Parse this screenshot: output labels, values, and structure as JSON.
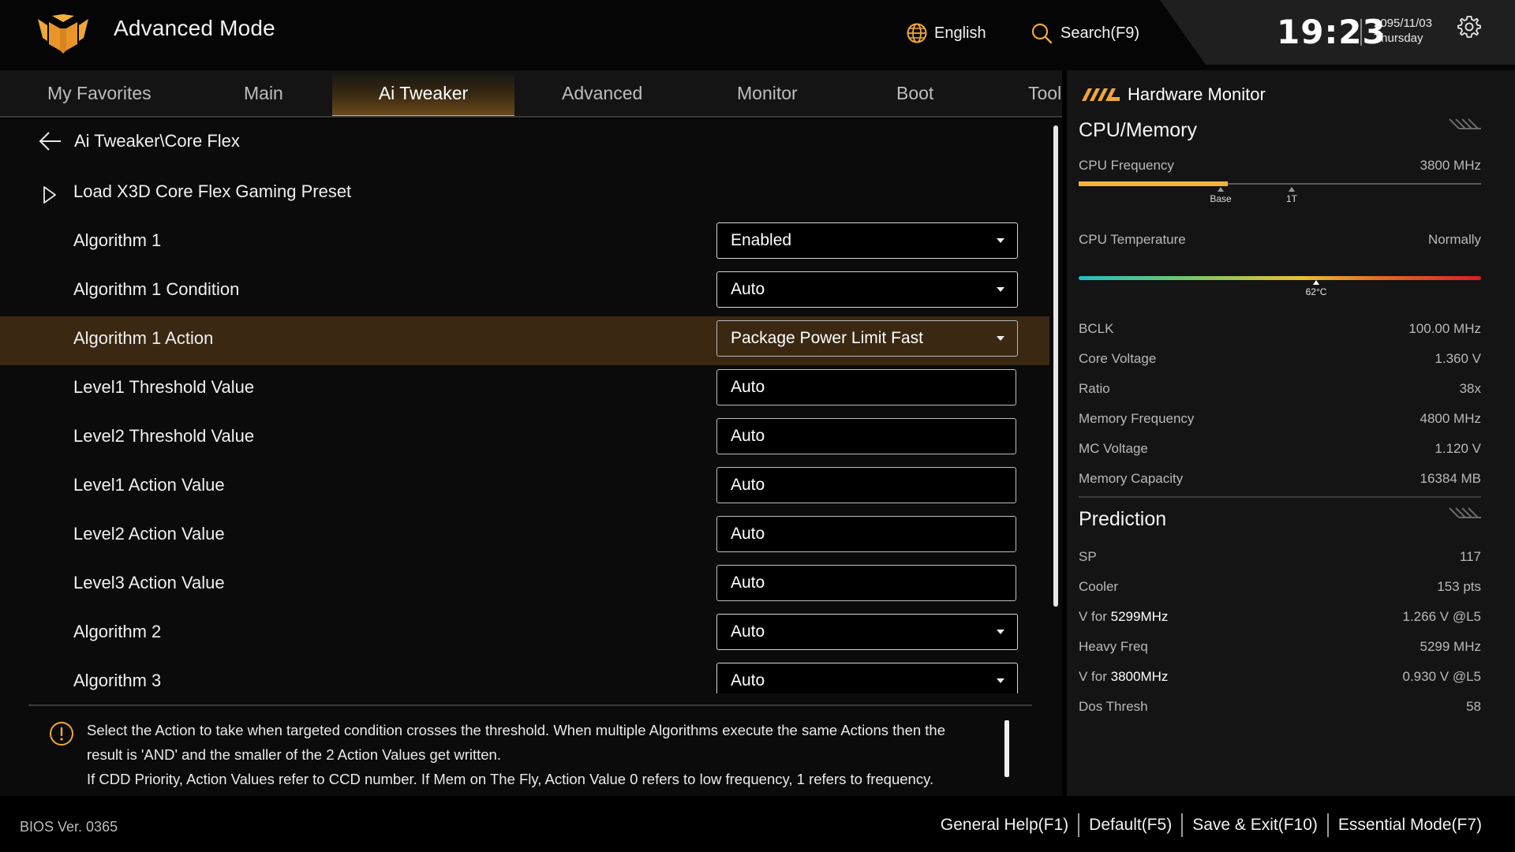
{
  "header": {
    "title": "Advanced Mode",
    "language": "English",
    "search": "Search(F9)",
    "time": "19:23",
    "date": "2095/11/03",
    "day": "Thursday",
    "accent_color": "#f0a73a"
  },
  "tabs": [
    {
      "label": "My Favorites",
      "active": false
    },
    {
      "label": "Main",
      "active": false
    },
    {
      "label": "Ai Tweaker",
      "active": true
    },
    {
      "label": "Advanced",
      "active": false
    },
    {
      "label": "Monitor",
      "active": false
    },
    {
      "label": "Boot",
      "active": false
    },
    {
      "label": "Tool",
      "active": false
    }
  ],
  "main": {
    "breadcrumb": "Ai Tweaker\\Core Flex",
    "preset": "Load X3D Core Flex Gaming Preset",
    "settings": [
      {
        "label": "Algorithm 1",
        "value": "Enabled",
        "control": "dropdown"
      },
      {
        "label": "Algorithm 1 Condition",
        "value": "Auto",
        "control": "dropdown"
      },
      {
        "label": "Algorithm 1 Action",
        "value": "Package Power Limit Fast",
        "control": "dropdown",
        "selected": true
      },
      {
        "label": "Level1 Threshold Value",
        "value": "Auto",
        "control": "input"
      },
      {
        "label": "Level2 Threshold Value",
        "value": "Auto",
        "control": "input"
      },
      {
        "label": "Level1 Action Value",
        "value": "Auto",
        "control": "input"
      },
      {
        "label": "Level2 Action Value",
        "value": "Auto",
        "control": "input"
      },
      {
        "label": "Level3 Action Value",
        "value": "Auto",
        "control": "input"
      },
      {
        "label": "Algorithm 2",
        "value": "Auto",
        "control": "dropdown"
      },
      {
        "label": "Algorithm 3",
        "value": "Auto",
        "control": "dropdown"
      }
    ],
    "help": {
      "line1": "Select the Action to take when targeted condition crosses the threshold. When multiple Algorithms execute the same Actions then the",
      "line2": "result is 'AND' and the smaller of the 2 Action Values get written.",
      "line3": "If CDD Priority, Action Values refer to CCD number. If Mem on The Fly, Action Value 0 refers to low frequency, 1 refers to frequency."
    }
  },
  "hardware_monitor": {
    "title": "Hardware Monitor",
    "cpu_memory": {
      "section": "CPU/Memory",
      "cpu_frequency_label": "CPU Frequency",
      "cpu_frequency_value": "3800 MHz",
      "cpu_frequency_fill": 0.37,
      "marker_base": "Base",
      "marker_1t": "1T",
      "cpu_temperature_label": "CPU Temperature",
      "cpu_temperature_status": "Normally",
      "cpu_temperature_marker": "62°C",
      "cpu_temperature_level": 0.59,
      "rows": [
        {
          "label": "BCLK",
          "value": "100.00 MHz"
        },
        {
          "label": "Core Voltage",
          "value": "1.360 V"
        },
        {
          "label": "Ratio",
          "value": "38x"
        },
        {
          "label": "Memory Frequency",
          "value": "4800 MHz"
        },
        {
          "label": "MC Voltage",
          "value": "1.120 V"
        },
        {
          "label": "Memory Capacity",
          "value": "16384 MB"
        }
      ]
    },
    "prediction": {
      "section": "Prediction",
      "sp_label": "SP",
      "sp_value": "117",
      "cooler_label": "Cooler",
      "cooler_value": "153 pts",
      "v1_prefix": "V for ",
      "v1_freq": "5299MHz",
      "v1_value": "1.266 V @L5",
      "heavy_label": "Heavy Freq",
      "heavy_value": "5299 MHz",
      "v2_prefix": "V for ",
      "v2_freq": "3800MHz",
      "v2_value": "0.930 V @L5",
      "dos_label": "Dos Thresh",
      "dos_value": "58"
    }
  },
  "footer": {
    "bios_version": "BIOS Ver. 0365",
    "buttons": [
      "General Help(F1)",
      "Default(F5)",
      "Save & Exit(F10)",
      "Essential Mode(F7)"
    ]
  }
}
